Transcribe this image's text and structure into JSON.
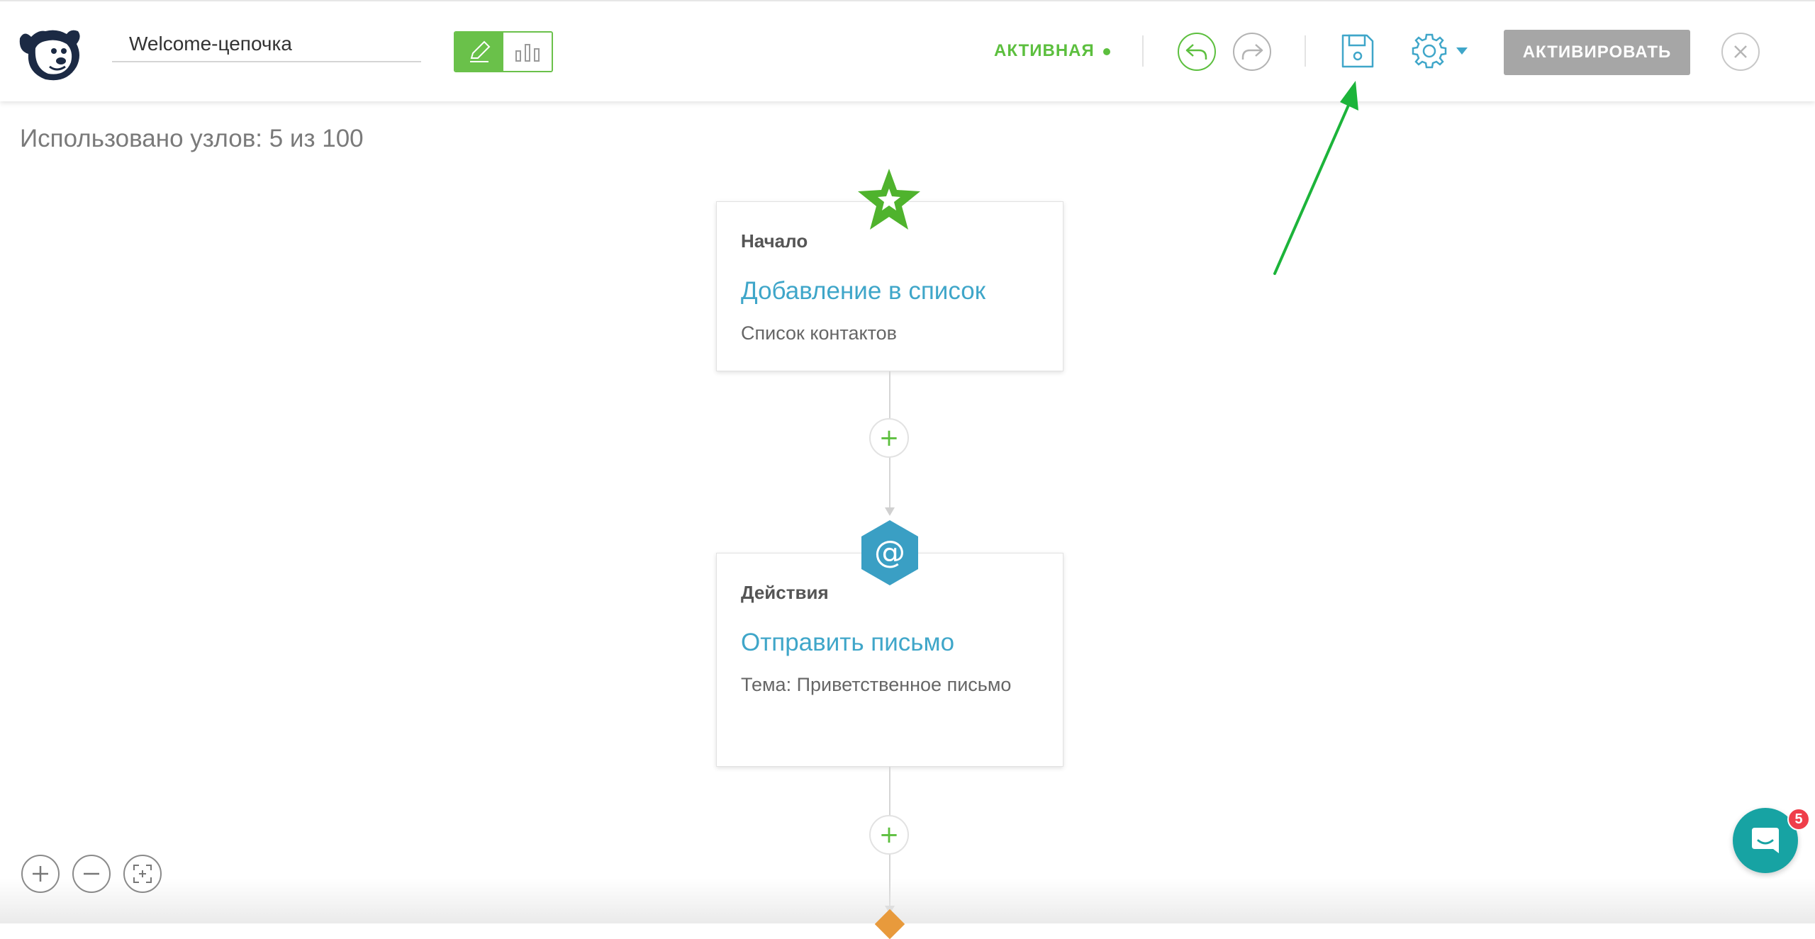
{
  "header": {
    "chain_name": "Welcome-цепочка",
    "status_label": "АКТИВНАЯ",
    "activate_label": "АКТИВИРОВАТЬ",
    "icons": {
      "logo": "dog-logo-icon",
      "edit": "pencil-icon",
      "stats": "bar-chart-icon",
      "undo": "undo-icon",
      "redo": "redo-icon",
      "save": "save-icon",
      "settings": "gear-icon",
      "close": "close-icon"
    },
    "colors": {
      "status": "#5cbf3e",
      "accent": "#3fa6c9",
      "toggle": "#6ac14a"
    }
  },
  "canvas": {
    "usage_text": "Использовано узлов: 5 из 100",
    "nodes": [
      {
        "kind": "Начало",
        "title": "Добавление в список",
        "subtitle": "Список контактов",
        "icon": "star-icon"
      },
      {
        "kind": "Действия",
        "title": "Отправить письмо",
        "subtitle": "Тема: Приветственное письмо",
        "icon": "at-sign-icon"
      }
    ],
    "add_step_symbol": "+"
  },
  "zoom_controls": {
    "zoom_in": "zoom-in-icon",
    "zoom_out": "zoom-out-icon",
    "fit": "fit-to-screen-icon"
  },
  "chat": {
    "unread_count": "5",
    "icon": "chat-icon"
  }
}
